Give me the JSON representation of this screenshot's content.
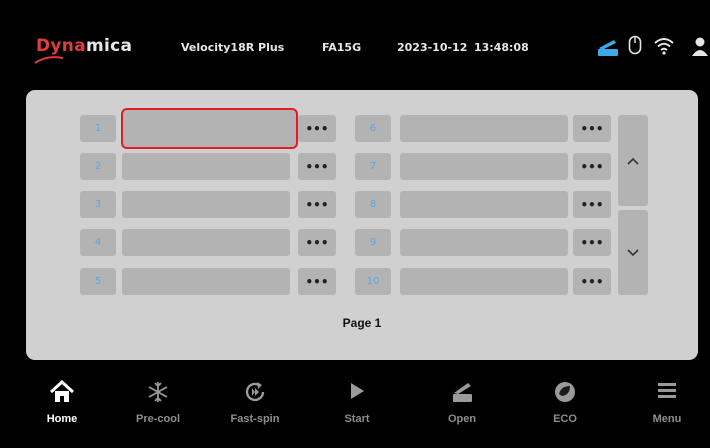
{
  "header": {
    "logo_red": "Dyna",
    "logo_white": "mica",
    "model": "Velocity18R Plus",
    "code": "FA15G",
    "date": "2023-10-12",
    "time": "13:48:08",
    "icons": [
      "open-lid-icon",
      "mouse-icon",
      "wifi-icon",
      "user-icon"
    ]
  },
  "programs": {
    "left": [
      {
        "num": "1",
        "label": "",
        "more": "•••"
      },
      {
        "num": "2",
        "label": "",
        "more": "•••"
      },
      {
        "num": "3",
        "label": "",
        "more": "•••"
      },
      {
        "num": "4",
        "label": "",
        "more": "•••"
      },
      {
        "num": "5",
        "label": "",
        "more": "•••"
      }
    ],
    "right": [
      {
        "num": "6",
        "label": "",
        "more": "•••"
      },
      {
        "num": "7",
        "label": "",
        "more": "•••"
      },
      {
        "num": "8",
        "label": "",
        "more": "•••"
      },
      {
        "num": "9",
        "label": "",
        "more": "•••"
      },
      {
        "num": "10",
        "label": "",
        "more": "•••"
      }
    ],
    "selected": 1,
    "page_label": "Page 1"
  },
  "nav": [
    {
      "label": "Home",
      "icon": "home-icon",
      "active": true
    },
    {
      "label": "Pre-cool",
      "icon": "snowflake-icon",
      "active": false
    },
    {
      "label": "Fast-spin",
      "icon": "fast-spin-icon",
      "active": false
    },
    {
      "label": "Start",
      "icon": "play-icon",
      "active": false
    },
    {
      "label": "Open",
      "icon": "open-lid-icon",
      "active": false
    },
    {
      "label": "ECO",
      "icon": "eco-icon",
      "active": false
    },
    {
      "label": "Menu",
      "icon": "menu-icon",
      "active": false
    }
  ],
  "colors": {
    "accent_red": "#e31b23",
    "number_blue": "#5aa6e6",
    "panel": "#d0d0d0",
    "cell": "#b3b3b3",
    "lid_icon_blue": "#3fa9e8"
  }
}
